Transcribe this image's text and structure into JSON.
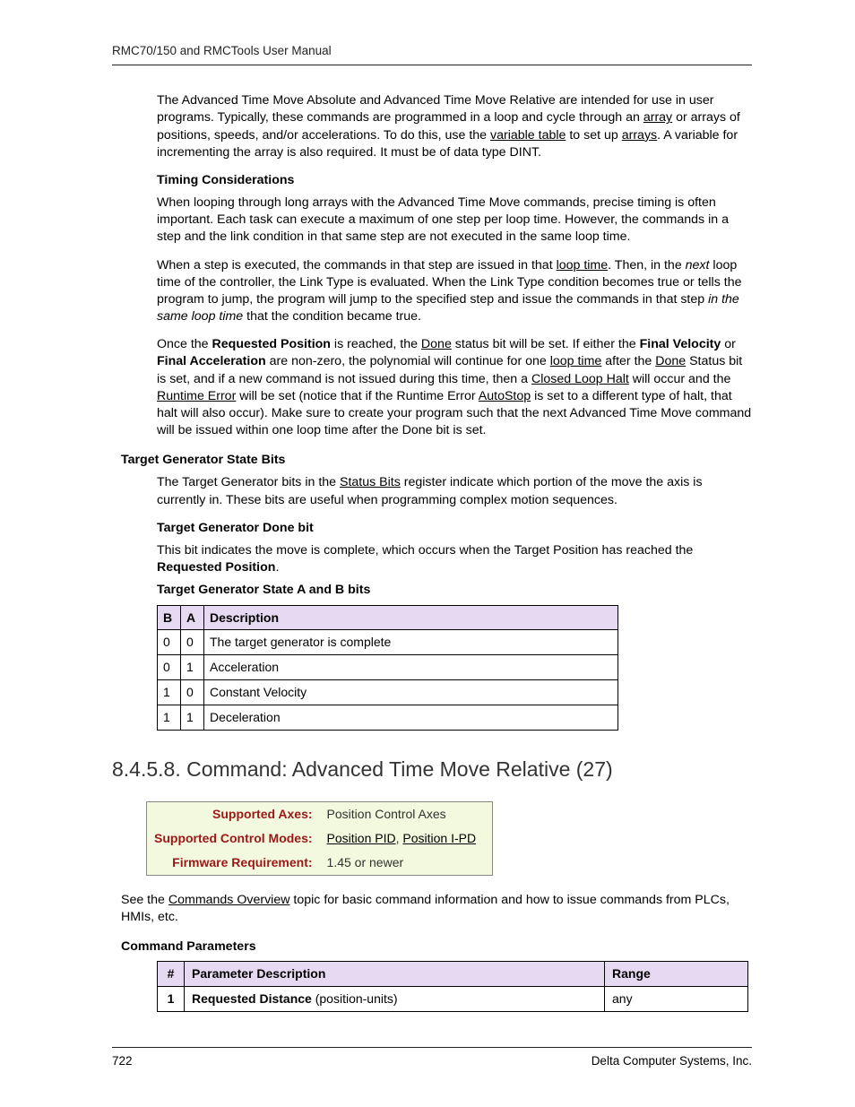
{
  "header": "RMC70/150 and RMCTools User Manual",
  "footer": {
    "page": "722",
    "company": "Delta Computer Systems, Inc."
  },
  "p1": {
    "t1": "The Advanced Time Move Absolute and Advanced Time Move Relative are intended for use in user programs. Typically, these commands are programmed in a loop and cycle through an ",
    "l1": "array",
    "t2": " or arrays of positions, speeds, and/or accelerations. To do this, use the ",
    "l2": "variable table",
    "t3": " to set up ",
    "l3": "arrays",
    "t4": ". A variable for incrementing the array is also required. It must be of data type DINT."
  },
  "tc_h": "Timing Considerations",
  "tc1": "When looping through long arrays with the Advanced Time Move commands, precise timing is often important. Each task can execute a maximum of one step per loop time. However, the commands in a step and the link condition in that same step are not executed in the same loop time.",
  "tc2": {
    "t1": "When a step is executed, the commands in that step are issued in that ",
    "l1": "loop time",
    "t2": ". Then, in the ",
    "i1": "next",
    "t3": " loop time of the controller, the Link Type is evaluated. When the Link Type condition becomes true or tells the program to jump, the program will jump to the specified step and issue the commands in that step ",
    "i2": "in the same loop time",
    "t4": " that the condition became true."
  },
  "tc3": {
    "t1": "Once the ",
    "b1": "Requested Position",
    "t2": " is reached, the ",
    "l1": "Done",
    "t3": " status bit will be set. If either the ",
    "b2": "Final Velocity",
    "t4": " or ",
    "b3": "Final Acceleration",
    "t5": " are non-zero, the polynomial will continue for one ",
    "l2": "loop time",
    "t6": " after the ",
    "l3": "Done",
    "t7": " Status bit is set, and if a new command is not issued during this time, then a ",
    "l4": "Closed Loop Halt",
    "t8": " will occur and the ",
    "l5": "Runtime Error",
    "t9": " will be set (notice that if the Runtime Error ",
    "l6": "AutoStop",
    "t10": " is set to a different type of halt, that halt will also occur). Make sure to create your program such that the next Advanced Time Move command will be issued within one loop time after the Done bit is set."
  },
  "tgsb_h": "Target Generator State Bits",
  "tgsb_p": {
    "t1": "The Target Generator bits in the ",
    "l1": "Status Bits",
    "t2": " register indicate which portion of the move the axis is currently in. These bits are useful when programming complex motion sequences."
  },
  "tgd_h": "Target Generator Done bit",
  "tgd_p": {
    "t1": "This bit indicates the move is complete, which occurs when the Target Position has reached the ",
    "b1": "Requested Position",
    "t2": "."
  },
  "tgab_h": "Target Generator State A and B bits",
  "tbl": {
    "h": {
      "b": "B",
      "a": "A",
      "d": "Description"
    },
    "rows": [
      {
        "b": "0",
        "a": "0",
        "d": "The target generator is complete"
      },
      {
        "b": "0",
        "a": "1",
        "d": "Acceleration"
      },
      {
        "b": "1",
        "a": "0",
        "d": "Constant Velocity"
      },
      {
        "b": "1",
        "a": "1",
        "d": "Deceleration"
      }
    ]
  },
  "sec_title": "8.4.5.8. Command: Advanced Time Move Relative (27)",
  "props": {
    "k1": "Supported Axes:",
    "v1": "Position Control Axes",
    "k2": "Supported Control Modes:",
    "v2a": "Position PID",
    "v2s": ", ",
    "v2b": "Position I-PD",
    "k3": "Firmware Requirement:",
    "v3": "1.45 or newer"
  },
  "see": {
    "t1": "See the ",
    "l1": "Commands Overview",
    "t2": " topic for basic command information and how to issue commands from PLCs, HMIs, etc."
  },
  "cp_h": "Command Parameters",
  "ptbl": {
    "h": {
      "n": "#",
      "d": "Parameter Description",
      "r": "Range"
    },
    "rows": [
      {
        "n": "1",
        "db": "Requested Distance",
        "dt": " (position-units)",
        "r": "any"
      }
    ]
  }
}
